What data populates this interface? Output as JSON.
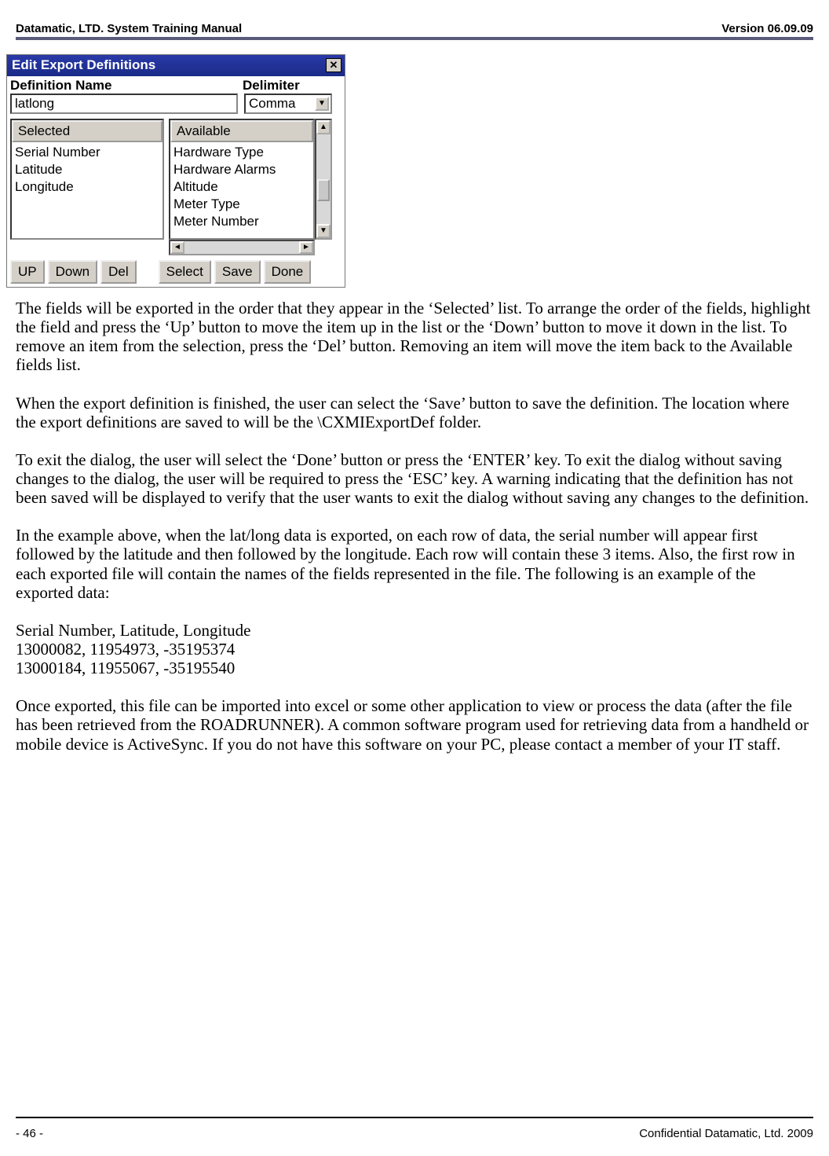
{
  "header": {
    "left": "Datamatic, LTD. System Training  Manual",
    "right": "Version 06.09.09"
  },
  "dialog": {
    "title": "Edit Export Definitions",
    "close_glyph": "✕",
    "defname_label": "Definition Name",
    "delimiter_label": "Delimiter",
    "defname_value": "latlong",
    "delimiter_value": "Comma",
    "selected_header": "Selected",
    "available_header": "Available",
    "selected_items": [
      "Serial Number",
      "Latitude",
      "Longitude"
    ],
    "available_items": [
      "Hardware Type",
      "Hardware Alarms",
      "Altitude",
      "Meter Type",
      "Meter Number"
    ],
    "buttons": {
      "up": "UP",
      "down": "Down",
      "del": "Del",
      "select": "Select",
      "save": "Save",
      "done": "Done"
    },
    "arrow_up": "▲",
    "arrow_down": "▼",
    "arrow_left": "◄",
    "arrow_right": "►"
  },
  "body": {
    "p1": "The fields will be exported in the order that they appear in the ‘Selected’ list.  To arrange the order of the fields, highlight the field and press the ‘Up’ button to move the item up in the list or the ‘Down’ button to move it down in the list.  To remove an item from the selection, press the ‘Del’ button.  Removing an item will move the item back to the Available fields list.",
    "p2": "When the export definition is finished, the user can select the ‘Save’ button to save the definition.  The location where the export definitions are saved to will be the \\CXMIExportDef folder.",
    "p3": "To exit the dialog, the user will select the ‘Done’ button or press the ‘ENTER’ key.  To exit the dialog without saving changes to the dialog, the user will be required to press the ‘ESC’ key.  A warning indicating that the definition has not been saved will be displayed to verify that the user wants to exit the dialog without saving any changes to the definition.",
    "p4": "In the example above, when the lat/long data is exported, on each row of data, the serial number will appear first followed by the latitude and then followed by the longitude.  Each row will contain these 3 items.  Also, the first row in each exported file will contain the names of the fields represented in the file.  The following is an example of the exported data:",
    "ex1": "Serial Number, Latitude, Longitude",
    "ex2": "13000082, 11954973, -35195374",
    "ex3": "13000184, 11955067, -35195540",
    "p5": "Once exported, this file can be imported into excel or some other application to view or process the data (after the file has been retrieved from the ROADRUNNER).  A common software program used for retrieving data from a handheld or mobile device is ActiveSync.  If you do not have this software on your PC, please contact a member of your IT staff."
  },
  "footer": {
    "left": "- 46 -",
    "right": "Confidential Datamatic, Ltd. 2009"
  }
}
